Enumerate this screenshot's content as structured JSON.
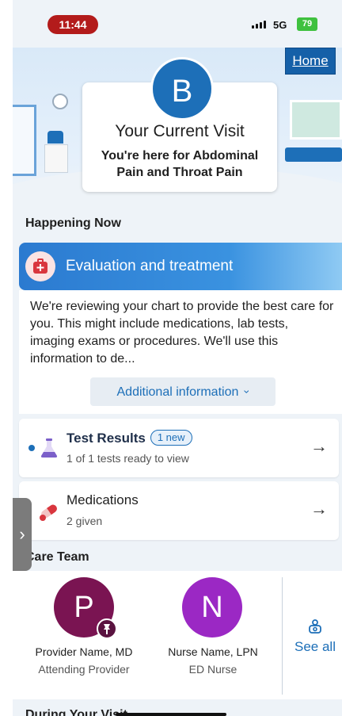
{
  "status_bar": {
    "time": "11:44",
    "network": "5G",
    "battery": "79"
  },
  "header": {
    "home_label": "Home",
    "avatar_letter": "B",
    "visit_title": "Your Current Visit",
    "visit_reason": "You're here for Abdominal Pain and Throat Pain"
  },
  "happening_now": {
    "title": "Happening Now",
    "banner_title": "Evaluation and treatment",
    "description": "We're reviewing your chart to provide the best care for you. This might include medications, lab tests, imaging exams  or procedures. We'll use this information to de...",
    "additional_label": "Additional information",
    "chevron": "›"
  },
  "cards": {
    "test_results": {
      "title": "Test Results",
      "badge": "1 new",
      "subtitle": "1 of 1 tests ready to view",
      "arrow": "→"
    },
    "medications": {
      "title": "Medications",
      "subtitle": "2 given",
      "arrow": "→"
    }
  },
  "care_team": {
    "title": "Care Team",
    "members": [
      {
        "letter": "P",
        "name": "Provider Name, MD",
        "role": "Attending Provider",
        "color": "#7a1452"
      },
      {
        "letter": "N",
        "name": "Nurse Name, LPN",
        "role": "ED Nurse",
        "color": "#9b28c4"
      }
    ],
    "see_all_label": "See all"
  },
  "during_visit": {
    "title": "During Your Visit"
  },
  "drawer": {
    "glyph": "›"
  },
  "colors": {
    "brand": "#1d6fb8",
    "alert": "#b31b1b"
  }
}
